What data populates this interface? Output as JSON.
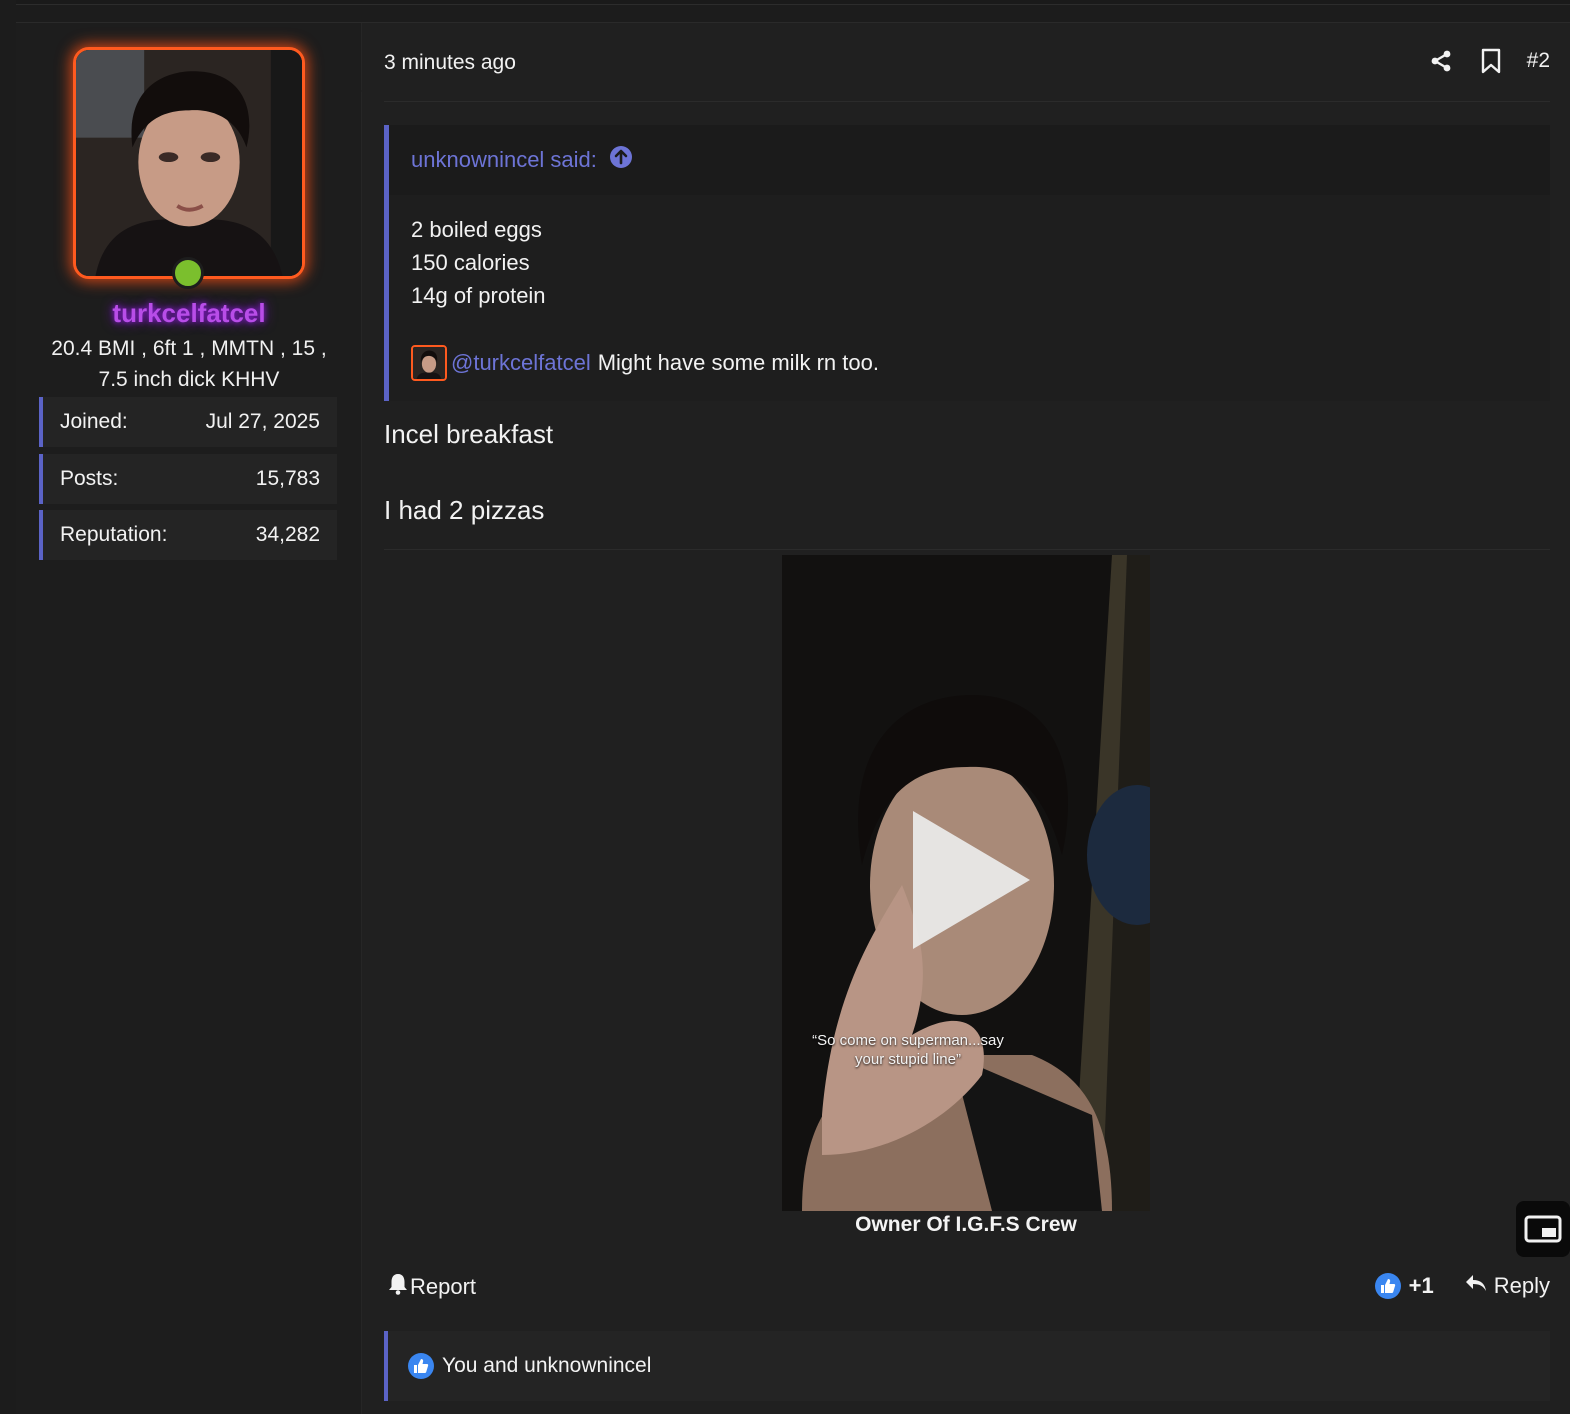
{
  "user": {
    "username": "turkcelfatcel",
    "title_line1": "20.4 BMI , 6ft 1 , MMTN , 15 ,",
    "title_line2": "7.5 inch dick KHHV",
    "stats": [
      {
        "label": "Joined:",
        "value": "Jul 27, 2025"
      },
      {
        "label": "Posts:",
        "value": "15,783"
      },
      {
        "label": "Reputation:",
        "value": "34,282"
      }
    ],
    "online": true
  },
  "post": {
    "date": "3 minutes ago",
    "number": "#2",
    "quote": {
      "author_said": "unknownincel said:",
      "lines": [
        "2 boiled eggs",
        "150 calories",
        "14g of protein"
      ],
      "mention": "@turkcelfatcel",
      "mention_text": "Might have some milk rn too."
    },
    "message": [
      "Incel breakfast",
      "I had 2 pizzas"
    ],
    "video": {
      "caption": "“So come on superman...say your stupid line”",
      "title": "Owner Of I.G.F.S Crew"
    },
    "footer": {
      "report_label": "Report",
      "like_count": "+1",
      "reply_label": "Reply"
    },
    "reactions_text": "You and unknownincel"
  },
  "icons": [
    "share-icon",
    "bookmark-icon",
    "arrow-up-circle-icon",
    "bell-icon",
    "like-icon",
    "reply-icon",
    "play-icon",
    "picture-in-picture-icon"
  ],
  "colors": {
    "accent": "#5b63c6",
    "link": "#6d74d6",
    "username": "#b84de8",
    "avatar_border": "#ff5a1f",
    "online": "#7bbf2d",
    "like": "#3a86f0"
  }
}
